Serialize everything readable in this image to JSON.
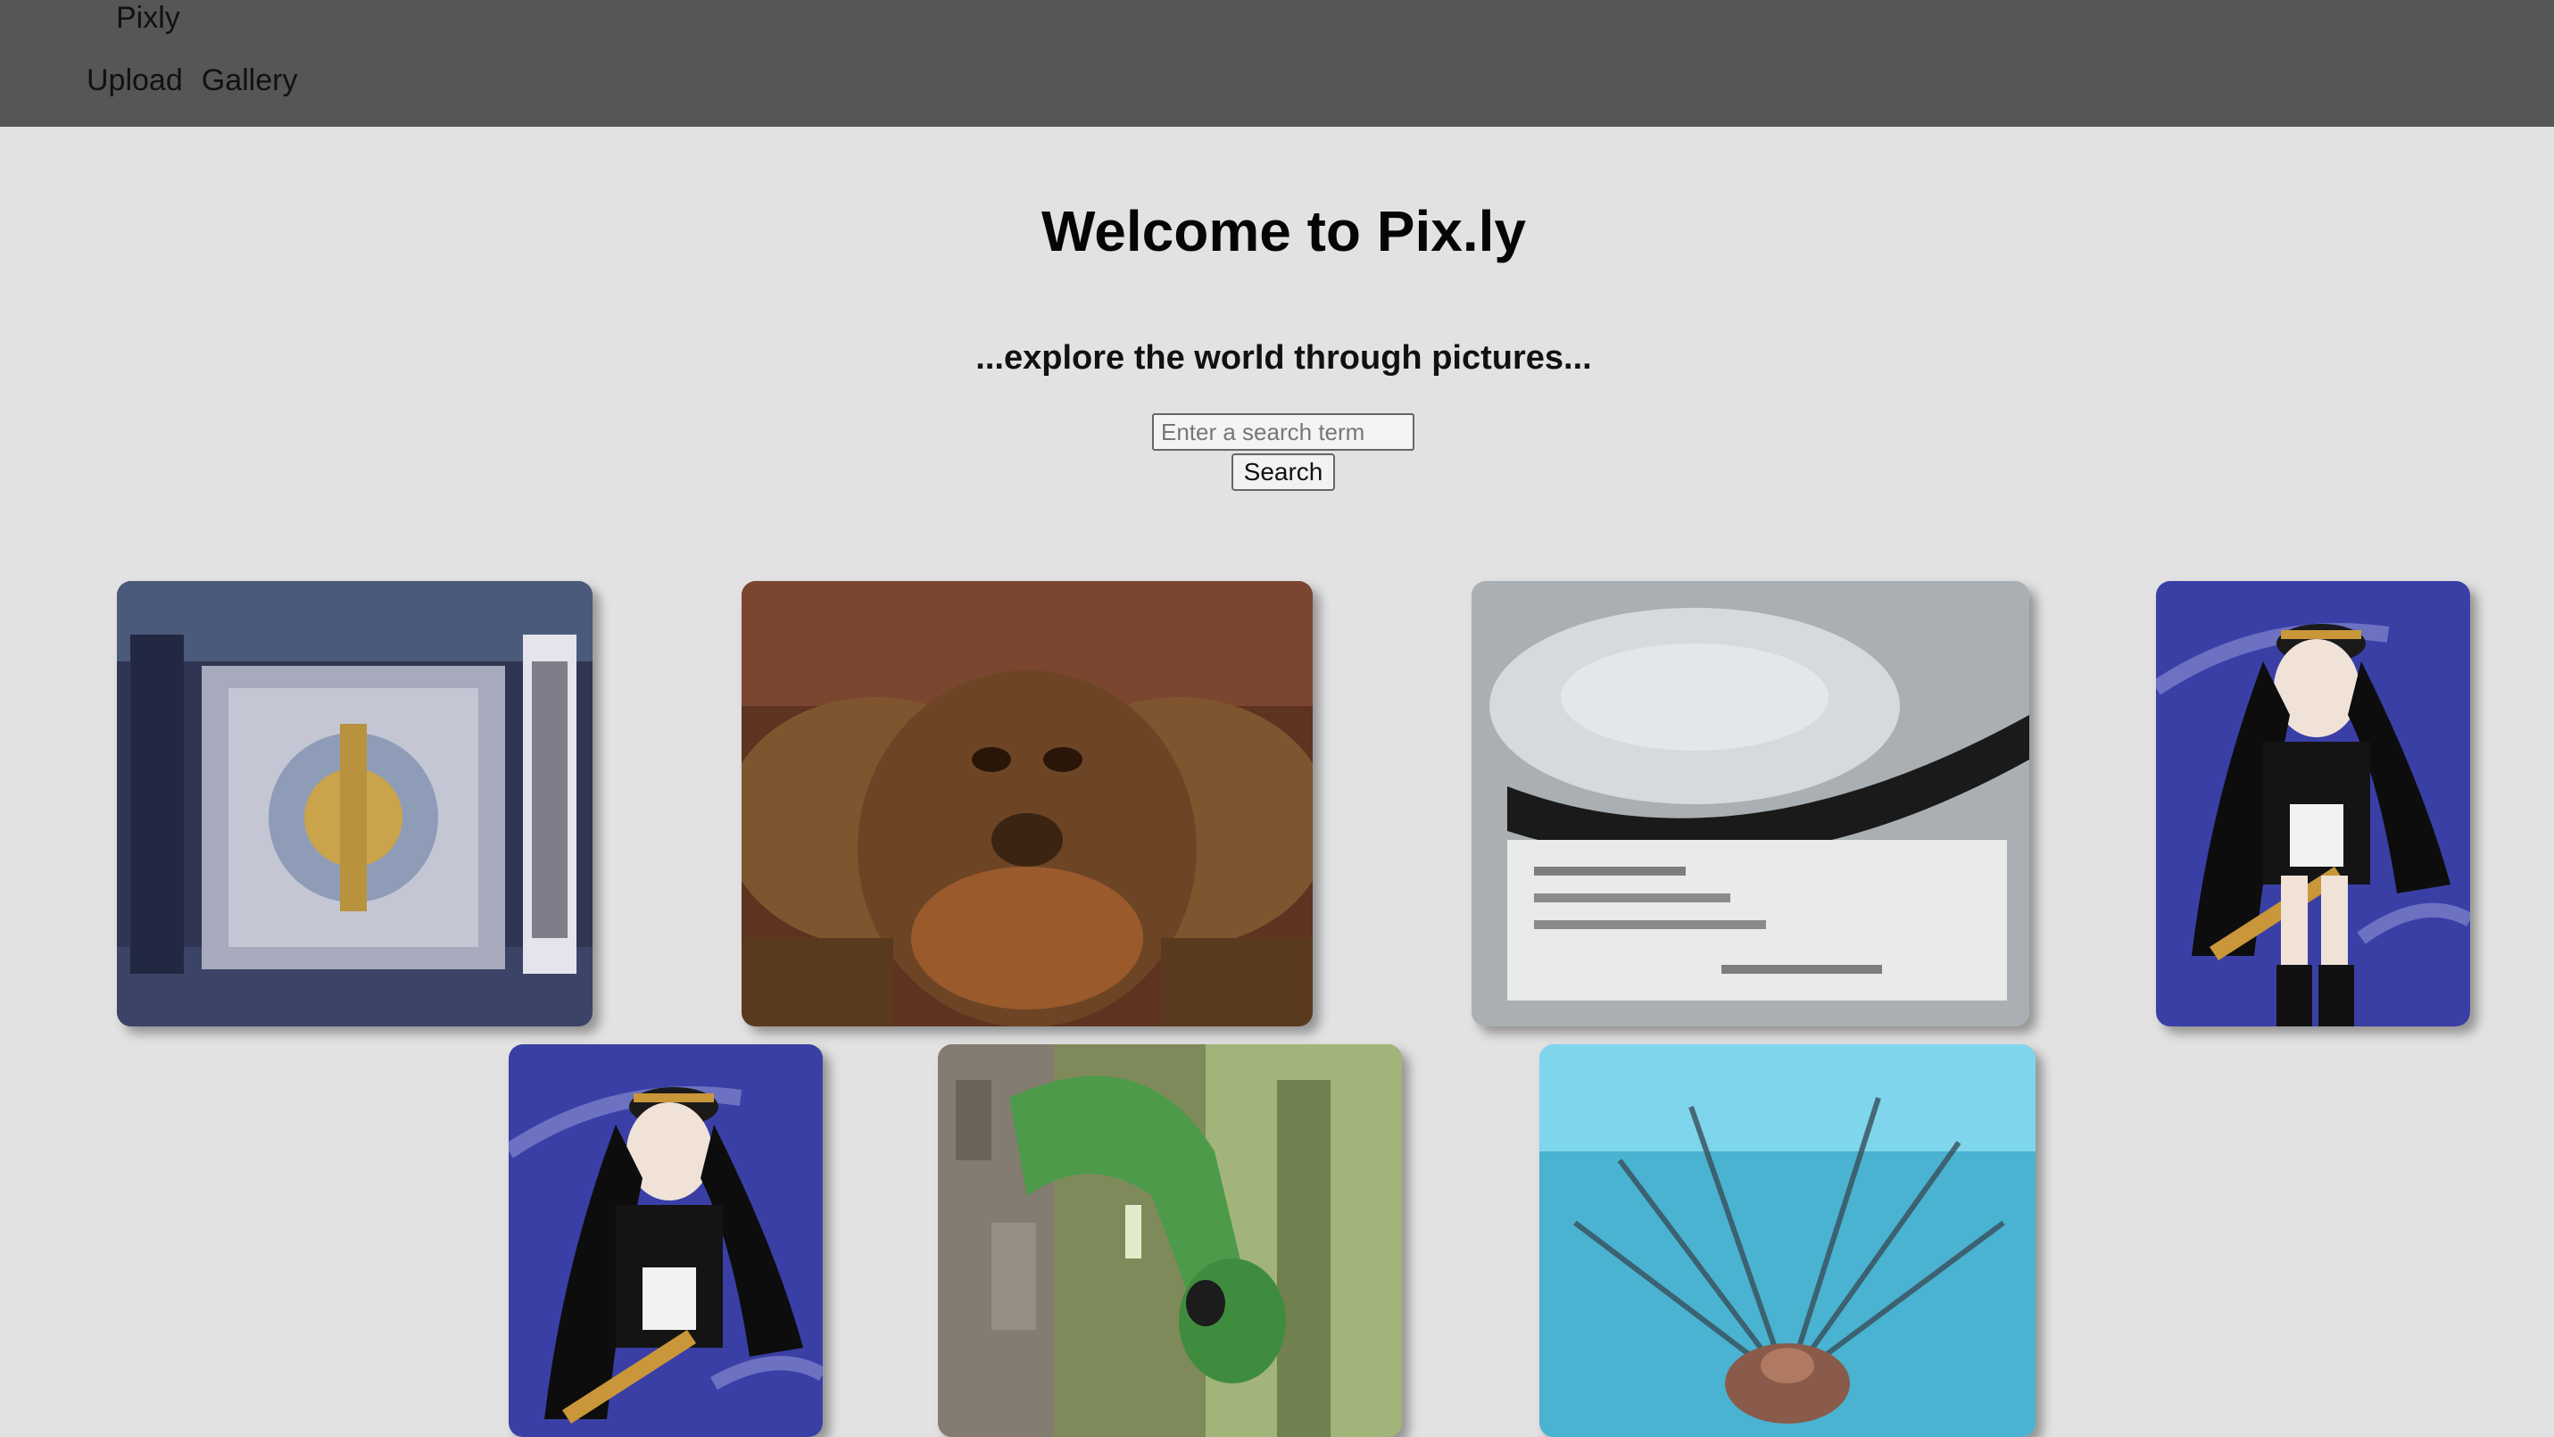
{
  "navbar": {
    "brand": "Pixly",
    "links": [
      {
        "label": "Upload"
      },
      {
        "label": "Gallery"
      }
    ]
  },
  "hero": {
    "title": "Welcome to Pix.ly",
    "subtitle": "...explore the world through pictures..."
  },
  "search": {
    "placeholder": "Enter a search term",
    "value": "",
    "button_label": "Search"
  },
  "gallery": {
    "images": [
      {
        "subject": "ornate-tapestry",
        "colors": [
          "#3b4162",
          "#a8a8b8",
          "#c9a44a"
        ]
      },
      {
        "subject": "orangutan",
        "colors": [
          "#6b3e22",
          "#8a5a32",
          "#3a2414"
        ]
      },
      {
        "subject": "film-reel",
        "colors": [
          "#c4cacf",
          "#1e1e1e",
          "#e8eaea"
        ]
      },
      {
        "subject": "anime-girl",
        "colors": [
          "#3a3fa6",
          "#0d0d0d",
          "#c9963a"
        ]
      },
      {
        "subject": "anime-girl",
        "colors": [
          "#3a3fa6",
          "#0d0d0d",
          "#c9963a"
        ]
      },
      {
        "subject": "green-lizard",
        "colors": [
          "#4c9a4a",
          "#7a7368",
          "#b7c18a"
        ]
      },
      {
        "subject": "lionfish",
        "colors": [
          "#4fb9d6",
          "#7a5a4a",
          "#c9e6ef"
        ]
      }
    ]
  }
}
